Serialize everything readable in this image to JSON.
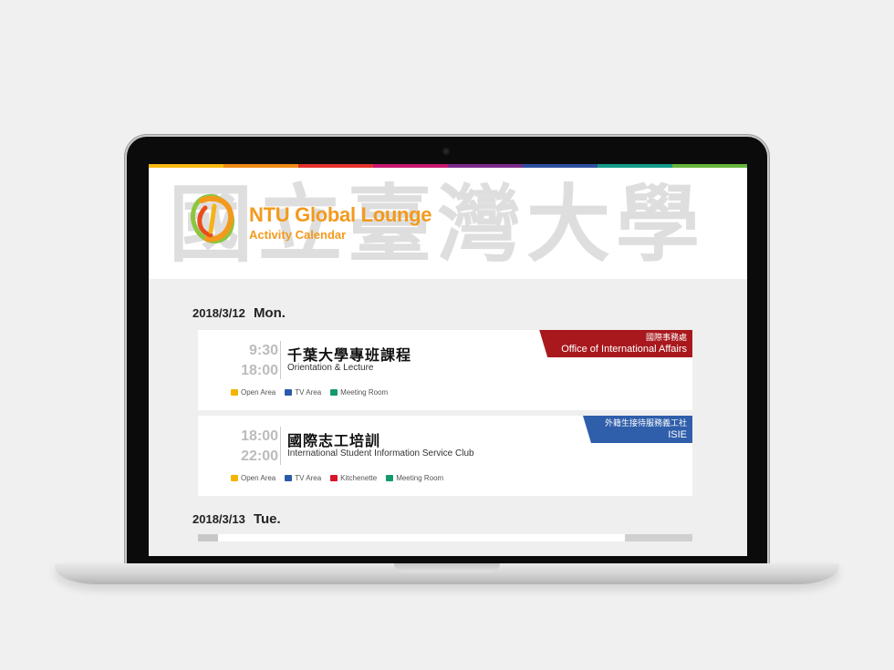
{
  "strip_colors": [
    "#f7b90e",
    "#f08a17",
    "#e5322c",
    "#c9156e",
    "#7d2a8c",
    "#2c4fa0",
    "#129a8a",
    "#66b53b"
  ],
  "header": {
    "calligraphy": "國立臺灣大學",
    "title": "NTU Global Lounge",
    "subtitle": "Activity Calendar",
    "accent": "#f39a1d"
  },
  "days": [
    {
      "date": "2018/3/12",
      "weekday": "Mon.",
      "events": [
        {
          "start": "9:30",
          "end": "18:00",
          "title_zh": "千葉大學專班課程",
          "title_en": "Orientation & Lecture",
          "org_zh": "國際事務處",
          "org_en": "Office of International Affairs",
          "org_color": "#a8181d",
          "tags": [
            {
              "label": "Open Area",
              "color": "#f4b400"
            },
            {
              "label": "TV Area",
              "color": "#2a5ba8"
            },
            {
              "label": "Meeting Room",
              "color": "#139a6b"
            }
          ]
        },
        {
          "start": "18:00",
          "end": "22:00",
          "title_zh": "國際志工培訓",
          "title_en": "International Student Information Service Club",
          "org_zh": "外籍生接待服務義工社",
          "org_en": "ISIE",
          "org_color": "#2f5eab",
          "tags": [
            {
              "label": "Open Area",
              "color": "#f4b400"
            },
            {
              "label": "TV Area",
              "color": "#2a5ba8"
            },
            {
              "label": "Kitchenette",
              "color": "#d9142b"
            },
            {
              "label": "Meeting Room",
              "color": "#139a6b"
            }
          ]
        }
      ]
    },
    {
      "date": "2018/3/13",
      "weekday": "Tue.",
      "events": []
    }
  ]
}
